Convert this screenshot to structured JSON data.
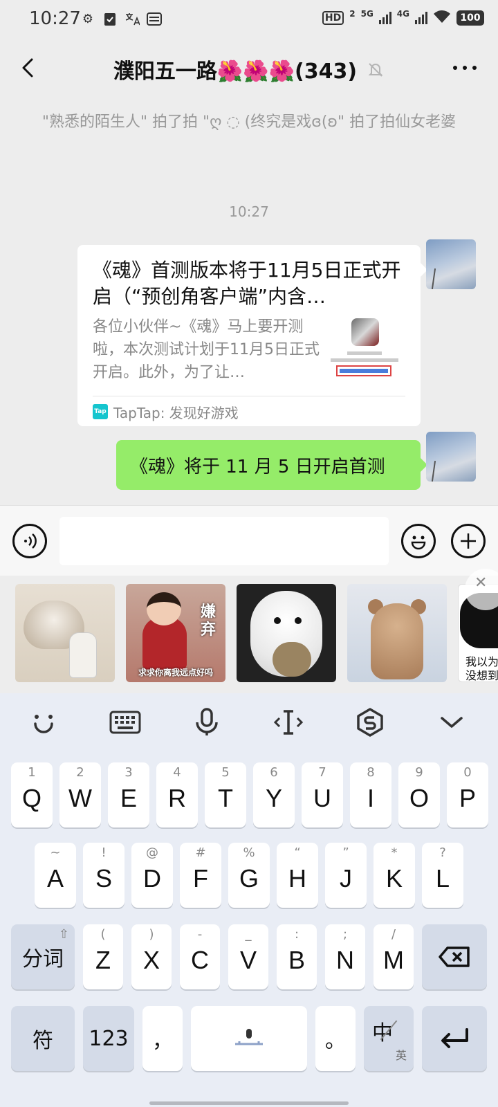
{
  "status_bar": {
    "time": "10:27",
    "left_icons": [
      "gear-icon",
      "clipboard-check-icon",
      "translate-icon",
      "wallet-icon"
    ],
    "hd_label": "HD",
    "hd_sub": "2",
    "net1": "5G",
    "net2": "4G",
    "battery": "100"
  },
  "header": {
    "title": "濮阳五一路🌺🌺🌺(343)",
    "back_icon": "back-chevron-icon",
    "mute_icon": "bell-off-icon",
    "more_icon": "more-icon"
  },
  "chat": {
    "system_message": "\"熟悉的陌生人\" 拍了拍 \"ღ ◌ (终究是戏ɞ(ʚ\" 拍了拍仙女老婆",
    "timestamp": "10:27",
    "link_card": {
      "title": "《魂》首测版本将于11月5日正式开启（“预创角客户端”内含…",
      "description": "各位小伙伴~《魂》马上要开测啦，本次测试计划于11月5日正式开启。此外，为了让…",
      "source": "TapTap: 发现好游戏",
      "source_icon_label": "Tap"
    },
    "text_bubble": "《魂》将于 11 月 5 日开启首测"
  },
  "input_bar": {
    "voice_icon": "voice-icon",
    "emoji_icon": "emoji-icon",
    "plus_icon": "plus-icon",
    "input_value": ""
  },
  "stickers": {
    "girl_text": "嫌弃",
    "girl_caption": "求求你离我远点好吗",
    "last_text_line1": "我以为",
    "last_text_line2": "没想到"
  },
  "keyboard": {
    "toolbar_icons": [
      "smile-icon",
      "keyboard-icon",
      "mic-icon",
      "cursor-icon",
      "sogou-icon",
      "collapse-icon"
    ],
    "row1": [
      {
        "key": "Q",
        "sub": "1"
      },
      {
        "key": "W",
        "sub": "2"
      },
      {
        "key": "E",
        "sub": "3"
      },
      {
        "key": "R",
        "sub": "4"
      },
      {
        "key": "T",
        "sub": "5"
      },
      {
        "key": "Y",
        "sub": "6"
      },
      {
        "key": "U",
        "sub": "7"
      },
      {
        "key": "I",
        "sub": "8"
      },
      {
        "key": "O",
        "sub": "9"
      },
      {
        "key": "P",
        "sub": "0"
      }
    ],
    "row2": [
      {
        "key": "A",
        "sub": "~"
      },
      {
        "key": "S",
        "sub": "!"
      },
      {
        "key": "D",
        "sub": "@"
      },
      {
        "key": "F",
        "sub": "#"
      },
      {
        "key": "G",
        "sub": "%"
      },
      {
        "key": "H",
        "sub": "“"
      },
      {
        "key": "J",
        "sub": "”"
      },
      {
        "key": "K",
        "sub": "*"
      },
      {
        "key": "L",
        "sub": "?"
      }
    ],
    "row3": [
      {
        "key": "Z",
        "sub": "("
      },
      {
        "key": "X",
        "sub": ")"
      },
      {
        "key": "C",
        "sub": "-"
      },
      {
        "key": "V",
        "sub": "_"
      },
      {
        "key": "B",
        "sub": ":"
      },
      {
        "key": "N",
        "sub": ";"
      },
      {
        "key": "M",
        "sub": "/"
      }
    ],
    "split_word": "分词",
    "symbols": "符",
    "numbers": "123",
    "comma": "，",
    "period": "。",
    "lang_main": "中",
    "lang_sub": "英"
  }
}
